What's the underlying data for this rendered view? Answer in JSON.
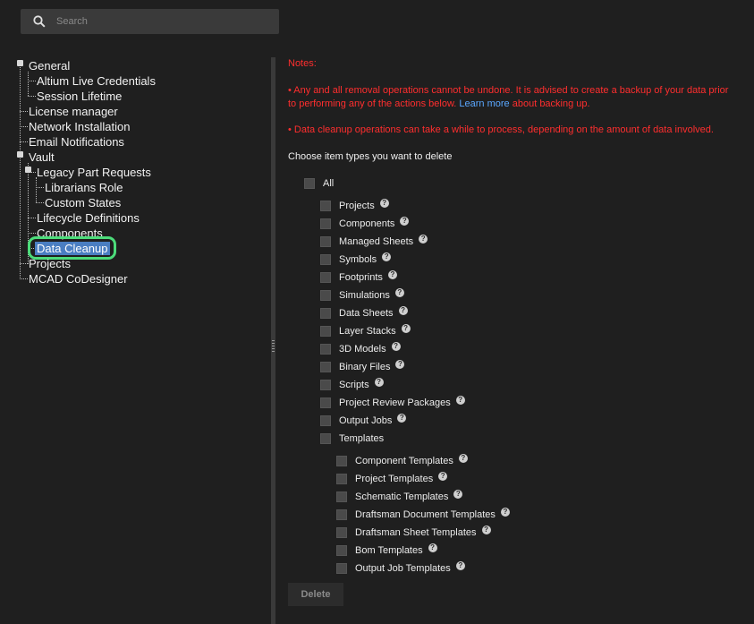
{
  "search": {
    "placeholder": "Search"
  },
  "tree": {
    "general": "General",
    "altium_live_credentials": "Altium Live Credentials",
    "session_lifetime": "Session Lifetime",
    "license_manager": "License manager",
    "network_installation": "Network Installation",
    "email_notifications": "Email Notifications",
    "vault": "Vault",
    "legacy_part_requests": "Legacy Part Requests",
    "librarians_role": "Librarians Role",
    "custom_states": "Custom States",
    "lifecycle_definitions": "Lifecycle Definitions",
    "components": "Components",
    "data_cleanup": "Data Cleanup",
    "projects": "Projects",
    "mcad_codesigner": "MCAD CoDesigner"
  },
  "notes": {
    "title": "Notes:",
    "note1_a": "• Any and all removal operations cannot be undone. It is advised to create a backup of your data prior to performing any of the actions below.",
    "note1_link": "Learn more",
    "note1_b": "about backing up.",
    "note2": "• Data cleanup operations can take a while to process, depending on the amount of data involved."
  },
  "choose_label": "Choose item types you want to delete",
  "all_label": "All",
  "item_types": [
    "Projects",
    "Components",
    "Managed Sheets",
    "Symbols",
    "Footprints",
    "Simulations",
    "Data Sheets",
    "Layer Stacks",
    "3D Models",
    "Binary Files",
    "Scripts",
    "Project Review Packages",
    "Output Jobs",
    "Templates"
  ],
  "template_types": [
    "Component Templates",
    "Project Templates",
    "Schematic Templates",
    "Draftsman Document Templates",
    "Draftsman Sheet Templates",
    "Bom Templates",
    "Output Job Templates"
  ],
  "help_glyph": "?",
  "delete_label": "Delete"
}
